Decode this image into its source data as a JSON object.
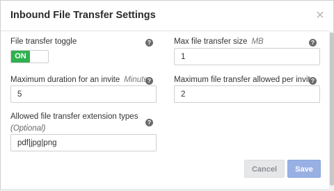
{
  "dialog": {
    "title": "Inbound File Transfer Settings",
    "close_glyph": "×"
  },
  "fields": {
    "toggle": {
      "label": "File transfer toggle",
      "state_label": "ON",
      "state": true
    },
    "max_size": {
      "label": "Max file transfer size",
      "unit": "MB",
      "value": "1"
    },
    "max_duration": {
      "label": "Maximum duration for an invite",
      "unit": "Minutes",
      "value": "5"
    },
    "max_per_invite": {
      "label": "Maximum file transfer allowed per invite",
      "value": "2"
    },
    "extensions": {
      "label": "Allowed file transfer extension types",
      "optional": "(Optional)",
      "value": "pdf|jpg|png"
    }
  },
  "help_glyph": "?",
  "footer": {
    "cancel_label": "Cancel",
    "save_label": "Save"
  },
  "colors": {
    "toggle_on": "#2fb14e",
    "save_button": "#98b0e3",
    "cancel_button": "#e6e7e9",
    "help_icon": "#6b6b6b"
  },
  "icons": [
    "close-icon",
    "help-icon"
  ]
}
